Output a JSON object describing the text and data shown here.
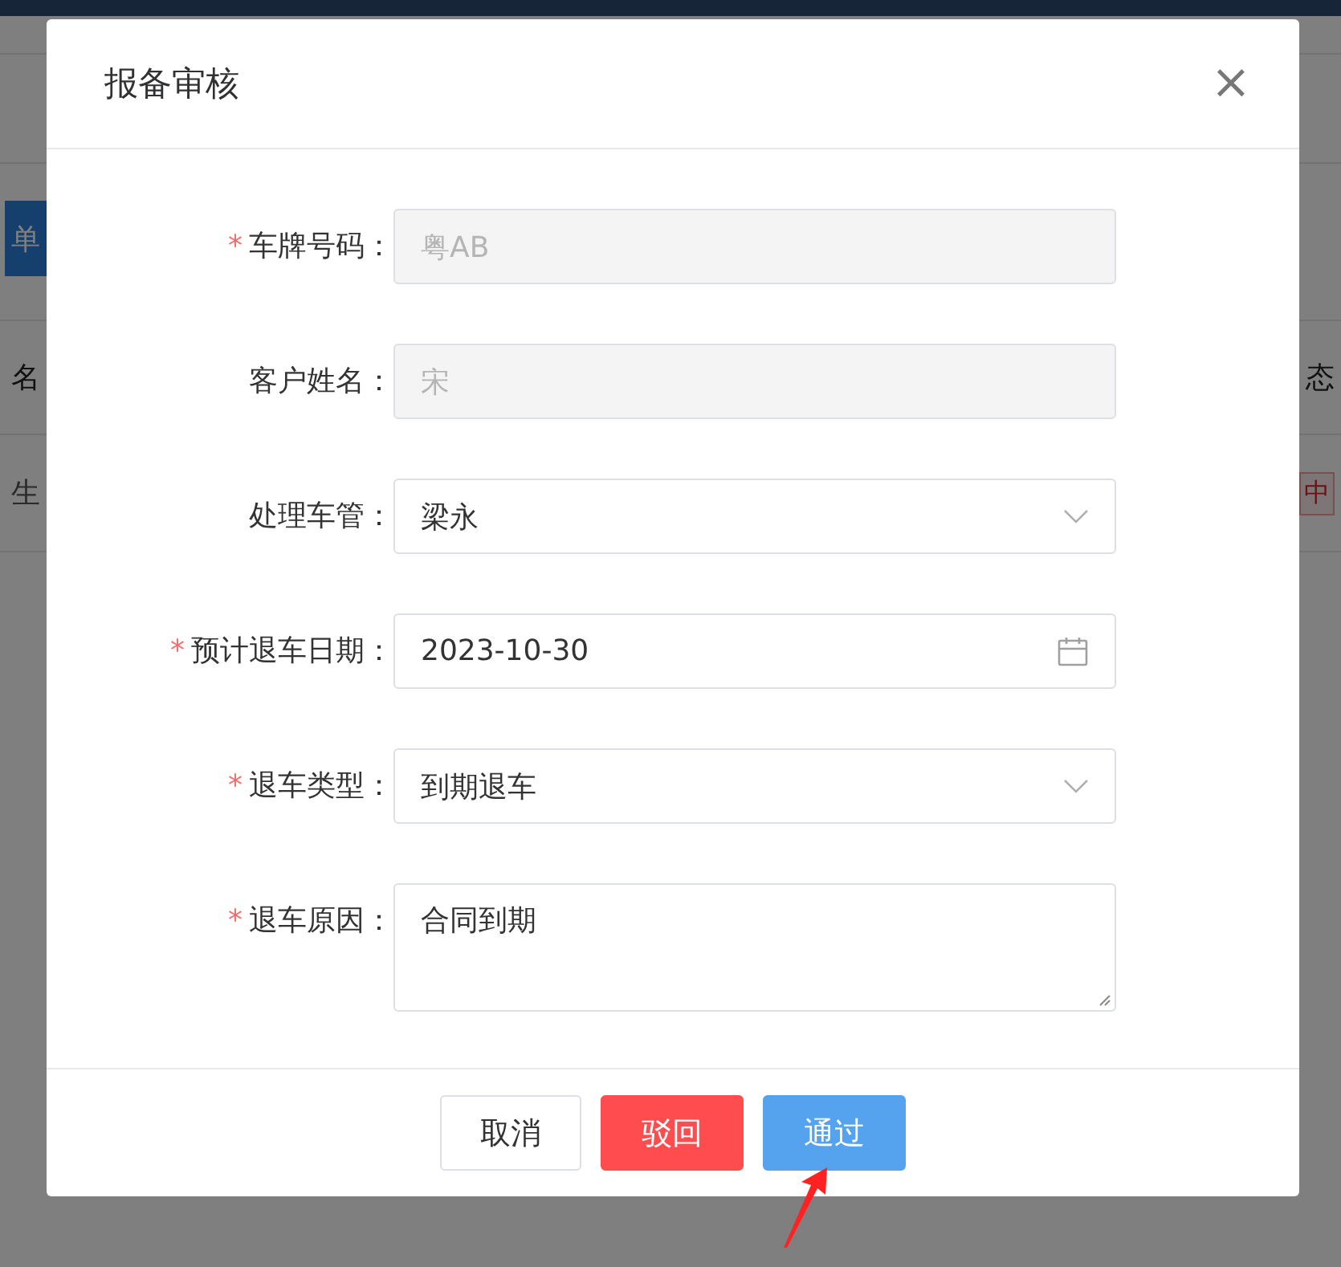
{
  "background": {
    "left": [
      {
        "text": "单",
        "kind": "button"
      },
      {
        "text": "名",
        "kind": "header"
      },
      {
        "text": "生",
        "kind": "cell"
      }
    ],
    "right": [
      {
        "text": "态",
        "kind": "header"
      },
      {
        "text": "中",
        "kind": "tag"
      }
    ]
  },
  "dialog": {
    "title": "报备审核",
    "close": "×",
    "required_mark": "*",
    "label_suffix": "：",
    "fields": [
      {
        "label": "车牌号码",
        "required": true,
        "kind": "input",
        "value": "粤AB",
        "disabled": true
      },
      {
        "label": "客户姓名",
        "required": false,
        "kind": "input",
        "value": "宋",
        "disabled": true
      },
      {
        "label": "处理车管",
        "required": false,
        "kind": "select",
        "value": "梁永",
        "disabled": false
      },
      {
        "label": "预计退车日期",
        "required": true,
        "kind": "date",
        "value": "2023-10-30",
        "disabled": false
      },
      {
        "label": "退车类型",
        "required": true,
        "kind": "select",
        "value": "到期退车",
        "disabled": false
      },
      {
        "label": "退车原因",
        "required": true,
        "kind": "textarea",
        "value": "合同到期",
        "disabled": false
      }
    ],
    "buttons": [
      {
        "label": "取消",
        "kind": "default"
      },
      {
        "label": "驳回",
        "kind": "danger"
      },
      {
        "label": "通过",
        "kind": "primary"
      }
    ]
  }
}
